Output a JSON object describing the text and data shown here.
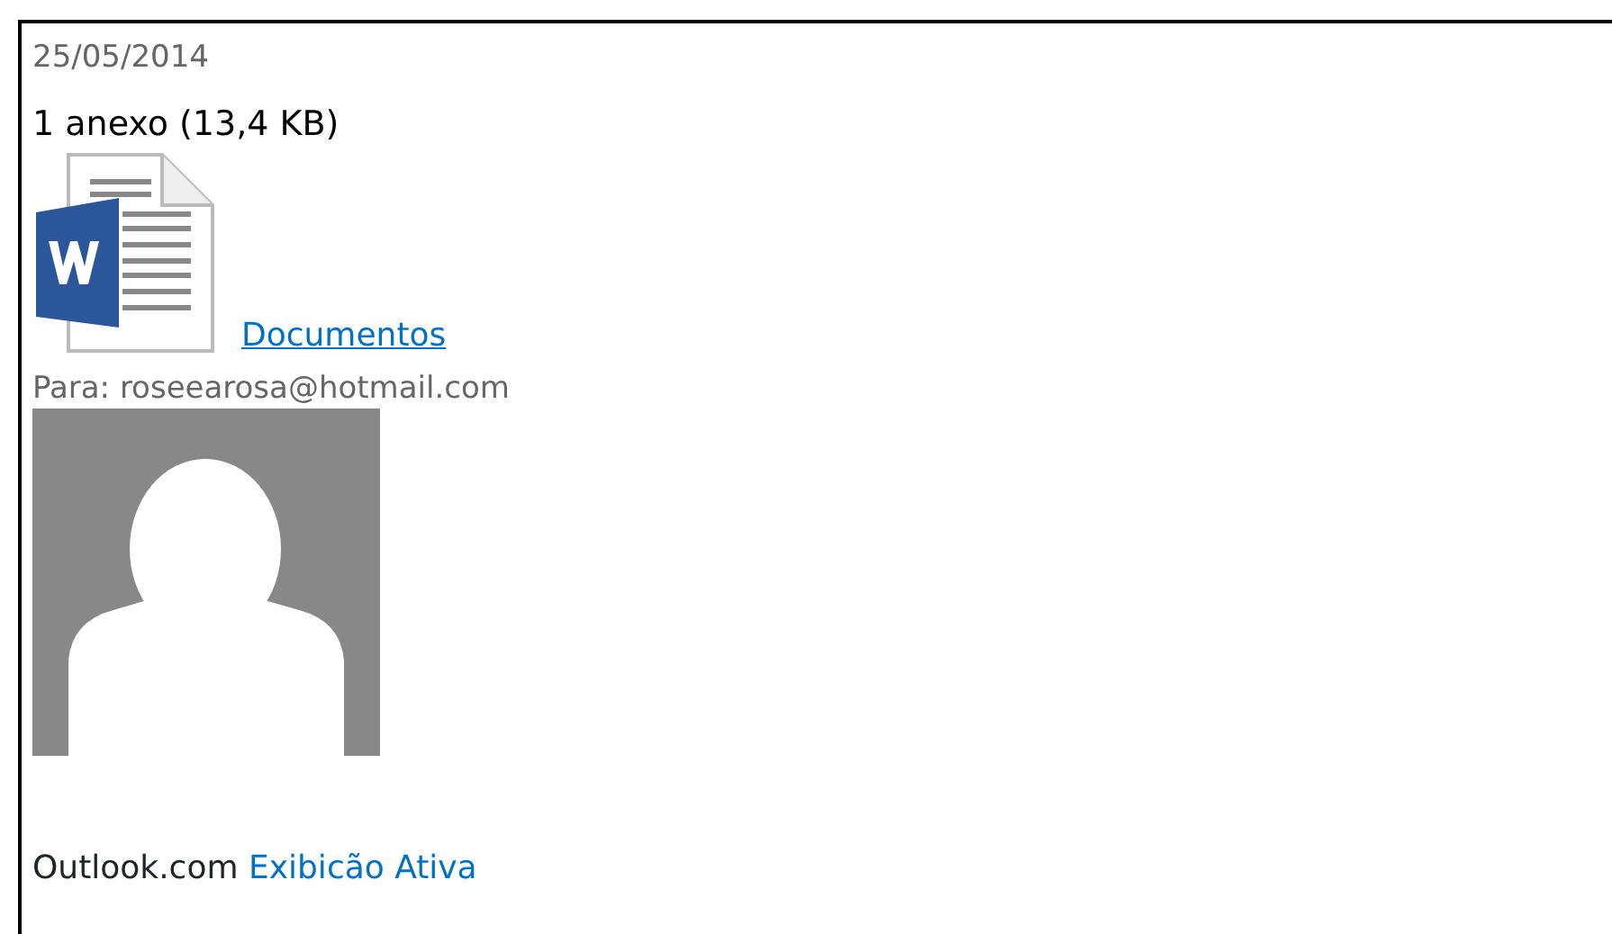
{
  "date": "25/05/2014",
  "attachments_summary": "1 anexo (13,4 KB)",
  "attachment": {
    "name": "Documentos"
  },
  "recipient": "Para: roseearosa@hotmail.com",
  "footer": {
    "brand": "Outlook.com",
    "link": "Exibicão Ativa"
  }
}
